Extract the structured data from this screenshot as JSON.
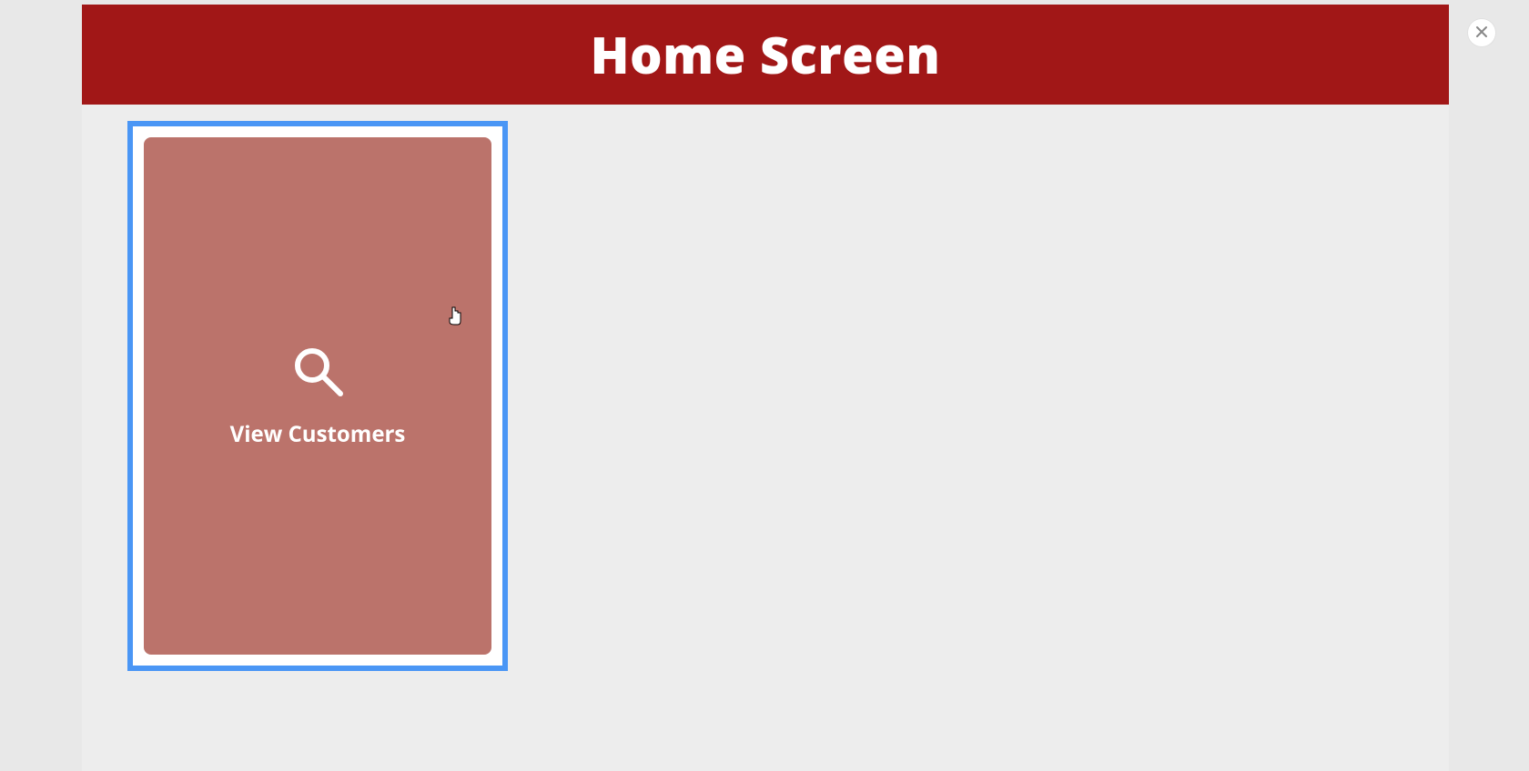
{
  "header": {
    "title": "Home Screen"
  },
  "cards": [
    {
      "icon": "search-icon",
      "label": "View Customers",
      "selected": true,
      "bgColor": "#bb736b",
      "borderColor": "#4a96f5"
    }
  ],
  "close": {
    "icon": "close-icon"
  }
}
